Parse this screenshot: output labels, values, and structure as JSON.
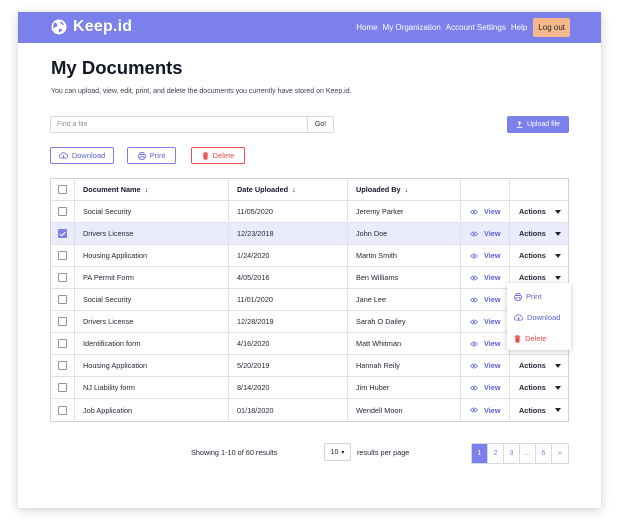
{
  "app": {
    "name": "Keep.id"
  },
  "nav": {
    "links": [
      "Home",
      "My Organization",
      "Account Settings",
      "Help"
    ],
    "logout_label": "Log out"
  },
  "page": {
    "title": "My Documents",
    "subtitle": "You can upload, view, edit, print, and delete the documents you currently have stored on Keep.id."
  },
  "search": {
    "placeholder": "Find a file",
    "go_label": "Go!"
  },
  "upload_label": "Upload file",
  "actions_bar": {
    "download": "Download",
    "print": "Print",
    "delete": "Delete"
  },
  "table": {
    "headers": {
      "name": "Document Name",
      "date": "Date Uploaded",
      "user": "Uploaded By",
      "sort_glyph": "↓"
    },
    "view_label": "View",
    "actions_label": "Actions",
    "rows": [
      {
        "name": "Social Security",
        "date": "11/05/2020",
        "user": "Jeremy Parker",
        "checked": false
      },
      {
        "name": "Drivers License",
        "date": "12/23/2018",
        "user": "John Doe",
        "checked": true
      },
      {
        "name": "Housing Application",
        "date": "1/24/2020",
        "user": "Martin Smith",
        "checked": false
      },
      {
        "name": "PA Permit Form",
        "date": "4/05/2016",
        "user": "Ben Williams",
        "checked": false
      },
      {
        "name": "Social Security",
        "date": "11/01/2020",
        "user": "Jane Lee",
        "checked": false
      },
      {
        "name": "Drivers License",
        "date": "12/28/2019",
        "user": "Sarah O Dailey",
        "checked": false
      },
      {
        "name": "Identification form",
        "date": "4/16/2020",
        "user": "Matt Whitman",
        "checked": false
      },
      {
        "name": "Housing Application",
        "date": "5/20/2019",
        "user": "Hannah Reily",
        "checked": false
      },
      {
        "name": "NJ Liability form",
        "date": "8/14/2020",
        "user": "Jim Huber",
        "checked": false
      },
      {
        "name": "Job Application",
        "date": "01/18/2020",
        "user": "Wendell Moon",
        "checked": false
      }
    ]
  },
  "dropdown": {
    "print": "Print",
    "download": "Download",
    "delete": "Delete"
  },
  "footer": {
    "showing": "Showing 1-10 of 60 results",
    "per_page_value": "10",
    "per_page_caret": "▾",
    "per_page_label": "results per page",
    "pages": [
      "1",
      "2",
      "3",
      "...",
      "6",
      "»"
    ]
  },
  "colors": {
    "accent": "#7b80ec",
    "danger": "#e5504f",
    "logout": "#f6b989",
    "selected_row": "#ebecfb"
  }
}
